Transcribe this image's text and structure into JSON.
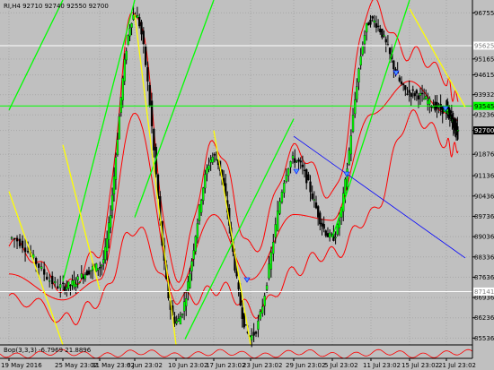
{
  "header": {
    "symbol_line": "RI,H4  92710 92740 92550 92700"
  },
  "indicator": {
    "label": "Bop(3,3,3) -6.7969 21.8896"
  },
  "price_axis": {
    "ticks": [
      "96755",
      "95165",
      "94615",
      "93932",
      "93236",
      "92700",
      "91876",
      "91136",
      "90436",
      "89736",
      "89036",
      "88336",
      "87636",
      "86936",
      "86236",
      "85536"
    ],
    "markers": [
      {
        "label": "95625",
        "value": 95625,
        "bg": "#ffffff",
        "fg": "#808080"
      },
      {
        "label": "93545",
        "value": 93545,
        "bg": "#00ff00",
        "fg": "#000000"
      },
      {
        "label": "92700",
        "value": 92700,
        "bg": "#000000",
        "fg": "#ffffff"
      },
      {
        "label": "87141",
        "value": 87141,
        "bg": "#ffffff",
        "fg": "#808080"
      }
    ]
  },
  "time_axis": {
    "labels": [
      "19 May 2016",
      "25 May 23:02",
      "31 May 23:02",
      "6 Jun 23:02",
      "10 Jun 23:02",
      "17 Jun 23:02",
      "23 Jun 23:02",
      "29 Jun 23:02",
      "5 Jul 23:02",
      "11 Jul 23:02",
      "15 Jul 23:02",
      "21 Jul 23:02"
    ]
  },
  "chart_data": {
    "type": "line",
    "title": "RI,H4",
    "ohlc_shown": {
      "open": 92710,
      "high": 92740,
      "low": 92550,
      "close": 92700
    },
    "ylim": [
      85300,
      97200
    ],
    "x": [
      "19 May 2016",
      "25 May 23:02",
      "31 May 23:02",
      "6 Jun 23:02",
      "10 Jun 23:02",
      "17 Jun 23:02",
      "23 Jun 23:02",
      "29 Jun 23:02",
      "5 Jul 23:02",
      "11 Jul 23:02",
      "15 Jul 23:02",
      "21 Jul 23:02",
      "22 Jul"
    ],
    "series": [
      {
        "name": "",
        "color": "#000000",
        "values": [
          89000,
          87300,
          88000,
          96700,
          86100,
          91800,
          85600,
          91700,
          89000,
          96500,
          94000,
          93400,
          92700
        ]
      },
      {
        "name": "",
        "color": "#ff0000",
        "values": [
          88700,
          87400,
          88400,
          97100,
          87500,
          92300,
          88600,
          91900,
          90600,
          96900,
          95500,
          94400,
          93900
        ]
      },
      {
        "name": "",
        "color": "#ff0000",
        "values": [
          86800,
          86300,
          86700,
          89500,
          86800,
          87300,
          86500,
          87700,
          88600,
          89600,
          93300,
          92200,
          92200
        ]
      }
    ],
    "horizontal_lines": [
      {
        "value": 95625,
        "color": "#ffffff"
      },
      {
        "value": 93545,
        "color": "#00ff00"
      },
      {
        "value": 87141,
        "color": "#ffffff"
      }
    ],
    "trend_lines": [
      {
        "color": "#00ff00",
        "from": [
          "19 May 2016",
          93400
        ],
        "to": [
          "25 May 23:02",
          97200
        ]
      },
      {
        "color": "#00ff00",
        "from": [
          "25 May 23:02",
          87500
        ],
        "to": [
          "6 Jun 23:02",
          97200
        ]
      },
      {
        "color": "#00ff00",
        "from": [
          "6 Jun 23:02",
          89700
        ],
        "to": [
          "17 Jun 23:02",
          97200
        ]
      },
      {
        "color": "#00ff00",
        "from": [
          "15 Jun",
          85500
        ],
        "to": [
          "29 Jun 23:02",
          93100
        ]
      },
      {
        "color": "#00ff00",
        "from": [
          "5 Jul 23:02",
          89000
        ],
        "to": [
          "15 Jul 23:02",
          97200
        ]
      },
      {
        "color": "#ffff00",
        "from": [
          "19 May 2016",
          90600
        ],
        "to": [
          "25 May 23:02",
          85300
        ]
      },
      {
        "color": "#ffff00",
        "from": [
          "25 May 23:02",
          92200
        ],
        "to": [
          "31 May 23:02",
          87200
        ]
      },
      {
        "color": "#ffff00",
        "from": [
          "6 Jun 23:02",
          96700
        ],
        "to": [
          "10 Jun 23:02",
          85300
        ]
      },
      {
        "color": "#ffff00",
        "from": [
          "17 Jun 23:02",
          92700
        ],
        "to": [
          "23 Jun 23:02",
          85300
        ]
      },
      {
        "color": "#ffff00",
        "from": [
          "15 Jul 23:02",
          96900
        ],
        "to": [
          "22 Jul",
          93500
        ]
      },
      {
        "color": "#0000ff",
        "from": [
          "29 Jun 23:02",
          92500
        ],
        "to": [
          "22 Jul",
          88300
        ]
      }
    ]
  }
}
